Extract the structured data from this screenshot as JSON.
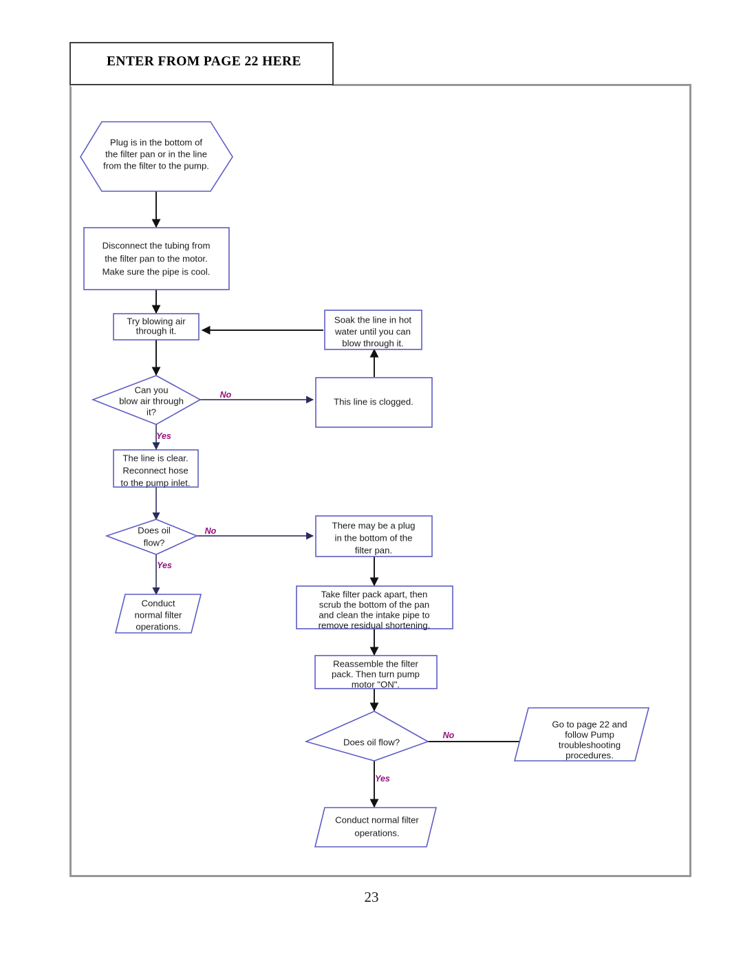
{
  "document": {
    "header_title": "ENTER FROM PAGE 22 HERE",
    "page_number": "23"
  },
  "colors": {
    "node_stroke": "#5c5cc4",
    "edge_stroke": "#3b3b6b",
    "edge_label": "#93117e",
    "frame": "#969696",
    "header_border": "#3f3f3f"
  },
  "chart_data": {
    "type": "diagram",
    "title": "ENTER FROM PAGE 22 HERE",
    "nodes": [
      {
        "id": "n1",
        "shape": "hexagon",
        "lines": [
          "Plug is in the bottom of",
          "the filter pan or in the line",
          "from the filter to the pump."
        ]
      },
      {
        "id": "n2",
        "shape": "process",
        "lines": [
          "Disconnect the tubing from",
          "the filter pan to the motor.",
          "Make sure the pipe is cool."
        ]
      },
      {
        "id": "n3",
        "shape": "process",
        "lines": [
          "Try blowing air",
          "through it."
        ]
      },
      {
        "id": "n4",
        "shape": "decision",
        "lines": [
          "Can you",
          "blow air through",
          "it?"
        ]
      },
      {
        "id": "n5",
        "shape": "process",
        "lines": [
          "This line is clogged."
        ]
      },
      {
        "id": "n6",
        "shape": "process",
        "lines": [
          "Soak the line in hot",
          "water until you can",
          "blow through it."
        ]
      },
      {
        "id": "n7",
        "shape": "process",
        "lines": [
          "The line is clear.",
          "Reconnect hose",
          "to the pump inlet."
        ]
      },
      {
        "id": "n8",
        "shape": "decision",
        "lines": [
          "Does oil",
          "flow?"
        ]
      },
      {
        "id": "n9",
        "shape": "process",
        "lines": [
          "There may be a plug",
          "in the bottom of the",
          "filter pan."
        ]
      },
      {
        "id": "n10",
        "shape": "parallelogram",
        "lines": [
          "Conduct",
          "normal filter",
          "operations."
        ]
      },
      {
        "id": "n11",
        "shape": "process",
        "lines": [
          "Take filter pack apart, then",
          "scrub the bottom of the pan",
          "and clean the intake pipe to",
          "remove residual shortening."
        ]
      },
      {
        "id": "n12",
        "shape": "process",
        "lines": [
          "Reassemble the filter",
          "pack.  Then turn pump",
          "motor \"ON\"."
        ]
      },
      {
        "id": "n13",
        "shape": "decision",
        "lines": [
          "Does oil flow?"
        ]
      },
      {
        "id": "n14",
        "shape": "parallelogram",
        "lines": [
          "Go to page 22 and",
          "follow Pump",
          "troubleshooting",
          "procedures."
        ]
      },
      {
        "id": "n15",
        "shape": "parallelogram",
        "lines": [
          "Conduct normal filter",
          "operations."
        ]
      }
    ],
    "edges": [
      {
        "from": "n1",
        "to": "n2",
        "label": ""
      },
      {
        "from": "n2",
        "to": "n3",
        "label": ""
      },
      {
        "from": "n3",
        "to": "n4",
        "label": ""
      },
      {
        "from": "n4",
        "to": "n5",
        "label": "No"
      },
      {
        "from": "n4",
        "to": "n7",
        "label": "Yes"
      },
      {
        "from": "n5",
        "to": "n6",
        "label": ""
      },
      {
        "from": "n6",
        "to": "n3",
        "label": ""
      },
      {
        "from": "n7",
        "to": "n8",
        "label": ""
      },
      {
        "from": "n8",
        "to": "n9",
        "label": "No"
      },
      {
        "from": "n8",
        "to": "n10",
        "label": "Yes"
      },
      {
        "from": "n9",
        "to": "n11",
        "label": ""
      },
      {
        "from": "n11",
        "to": "n12",
        "label": ""
      },
      {
        "from": "n12",
        "to": "n13",
        "label": ""
      },
      {
        "from": "n13",
        "to": "n14",
        "label": "No"
      },
      {
        "from": "n13",
        "to": "n15",
        "label": "Yes"
      }
    ],
    "edge_labels": {
      "e_n4_no": "No",
      "e_n4_yes": "Yes",
      "e_n8_no": "No",
      "e_n8_yes": "Yes",
      "e_n13_no": "No",
      "e_n13_yes": "Yes"
    }
  },
  "nodes": {
    "n1": {
      "l0": "Plug is in the bottom of",
      "l1": "the filter pan or in the line",
      "l2": "from the filter to the pump."
    },
    "n2": {
      "l0": "Disconnect the tubing from",
      "l1": "the filter pan to the motor.",
      "l2": "Make sure the pipe is cool."
    },
    "n3": {
      "l0": "Try blowing air",
      "l1": "through it."
    },
    "n4": {
      "l0": "Can you",
      "l1": "blow air through",
      "l2": "it?"
    },
    "n5": {
      "l0": "This line is clogged."
    },
    "n6": {
      "l0": "Soak the line in hot",
      "l1": "water until you can",
      "l2": "blow through it."
    },
    "n7": {
      "l0": "The line is clear.",
      "l1": "Reconnect hose",
      "l2": "to the pump inlet."
    },
    "n8": {
      "l0": "Does oil",
      "l1": "flow?"
    },
    "n9": {
      "l0": "There may be a plug",
      "l1": "in the bottom of the",
      "l2": "filter pan."
    },
    "n10": {
      "l0": "Conduct",
      "l1": "normal filter",
      "l2": "operations."
    },
    "n11": {
      "l0": "Take filter pack apart, then",
      "l1": "scrub the bottom of the pan",
      "l2": "and clean the intake pipe to",
      "l3": "remove residual shortening."
    },
    "n12": {
      "l0": "Reassemble the filter",
      "l1": "pack.  Then turn pump",
      "l2": "motor \"ON\"."
    },
    "n13": {
      "l0": "Does oil flow?"
    },
    "n14": {
      "l0": "Go to page 22 and",
      "l1": "follow Pump",
      "l2": "troubleshooting",
      "l3": "procedures."
    },
    "n15": {
      "l0": "Conduct normal filter",
      "l1": "operations."
    }
  }
}
